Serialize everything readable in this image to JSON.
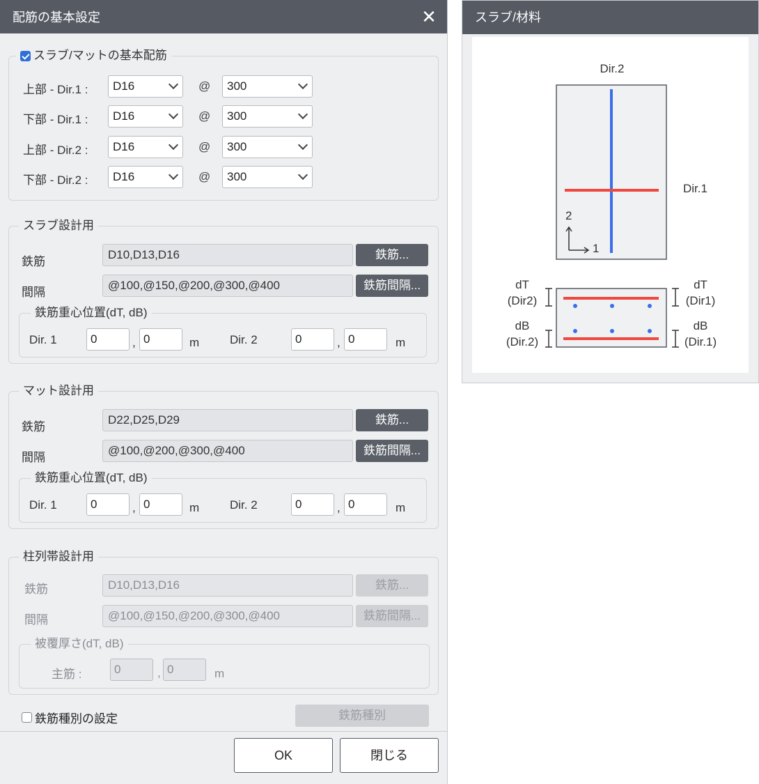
{
  "dialog": {
    "title": "配筋の基本設定",
    "close_glyph": "✕",
    "basic": {
      "checkbox_label": "スラブ/マットの基本配筋",
      "checked": true,
      "at_symbol": "@",
      "rows": [
        {
          "label": "上部 - Dir.1 :",
          "bar": "D16",
          "spacing": "300"
        },
        {
          "label": "下部 - Dir.1 :",
          "bar": "D16",
          "spacing": "300"
        },
        {
          "label": "上部 - Dir.2 :",
          "bar": "D16",
          "spacing": "300"
        },
        {
          "label": "下部 - Dir.2 :",
          "bar": "D16",
          "spacing": "300"
        }
      ]
    },
    "slab": {
      "legend": "スラブ設計用",
      "rebar_label": "鉄筋",
      "rebar_value": "D10,D13,D16",
      "rebar_button": "鉄筋...",
      "spacing_label": "間隔",
      "spacing_value": "@100,@150,@200,@300,@400",
      "spacing_button": "鉄筋間隔...",
      "centroid_legend": "鉄筋重心位置(dT, dB)",
      "dir1_label": "Dir. 1",
      "dir1_dT": "0",
      "dir1_dB": "0",
      "dir2_label": "Dir. 2",
      "dir2_dT": "0",
      "dir2_dB": "0",
      "unit": "m",
      "comma": ","
    },
    "mat": {
      "legend": "マット設計用",
      "rebar_label": "鉄筋",
      "rebar_value": "D22,D25,D29",
      "rebar_button": "鉄筋...",
      "spacing_label": "間隔",
      "spacing_value": "@100,@200,@300,@400",
      "spacing_button": "鉄筋間隔...",
      "centroid_legend": "鉄筋重心位置(dT, dB)",
      "dir1_label": "Dir. 1",
      "dir1_dT": "0",
      "dir1_dB": "0",
      "dir2_label": "Dir. 2",
      "dir2_dT": "0",
      "dir2_dB": "0",
      "unit": "m",
      "comma": ","
    },
    "column_strip": {
      "legend": "柱列帯設計用",
      "rebar_label": "鉄筋",
      "rebar_value": "D10,D13,D16",
      "rebar_button": "鉄筋...",
      "spacing_label": "間隔",
      "spacing_value": "@100,@150,@200,@300,@400",
      "spacing_button": "鉄筋間隔...",
      "cover_legend": "被覆厚さ(dT, dB)",
      "main_label": "主筋 :",
      "main_dT": "0",
      "main_dB": "0",
      "unit": "m",
      "comma": ","
    },
    "rebar_type": {
      "checkbox_label": "鉄筋種別の設定",
      "checked": false,
      "button": "鉄筋種別"
    },
    "ok_button": "OK",
    "close_button": "閉じる"
  },
  "panel": {
    "title": "スラブ/材料",
    "diagram": {
      "dir2": "Dir.2",
      "dir1": "Dir.1",
      "axis_2": "2",
      "axis_1": "1",
      "dT": "dT",
      "dir2_paren": "(Dir2)",
      "dir1_paren": "(Dir1)",
      "dB": "dB",
      "dir2_paren_b": "(Dir.2)",
      "dir1_paren_b": "(Dir.1)"
    },
    "colors": {
      "dir1_bar": "#f0483e",
      "dir2_bar": "#3b6fe8",
      "slab_fill": "#f0f1f3",
      "slab_stroke": "#555a63"
    }
  }
}
